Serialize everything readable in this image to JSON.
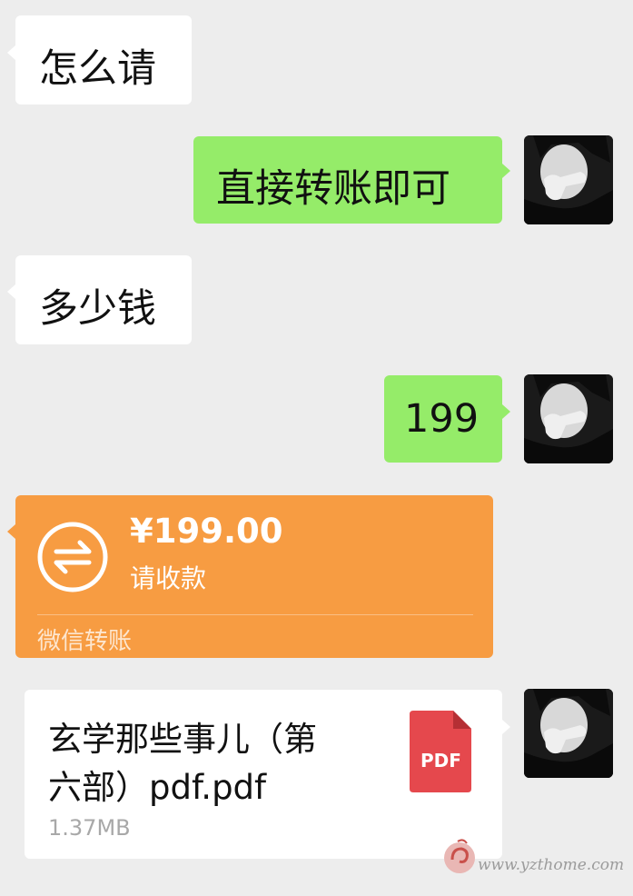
{
  "messages": {
    "m1": {
      "text": "怎么请"
    },
    "m2": {
      "text": "直接转账即可"
    },
    "m3": {
      "text": "多少钱"
    },
    "m4": {
      "text": "199"
    }
  },
  "transfer": {
    "amount": "¥199.00",
    "status": "请收款",
    "footer": "微信转账",
    "color": "#f79c42"
  },
  "file": {
    "name_line1": "玄学那些事儿（第",
    "name_line2": "六部）pdf.pdf",
    "size": "1.37MB",
    "icon_label": "PDF",
    "icon_color": "#e5484d"
  },
  "watermark": {
    "url": "www.yzthome.com"
  },
  "colors": {
    "background": "#ededed",
    "sent_bubble": "#95ec69",
    "received_bubble": "#ffffff"
  }
}
